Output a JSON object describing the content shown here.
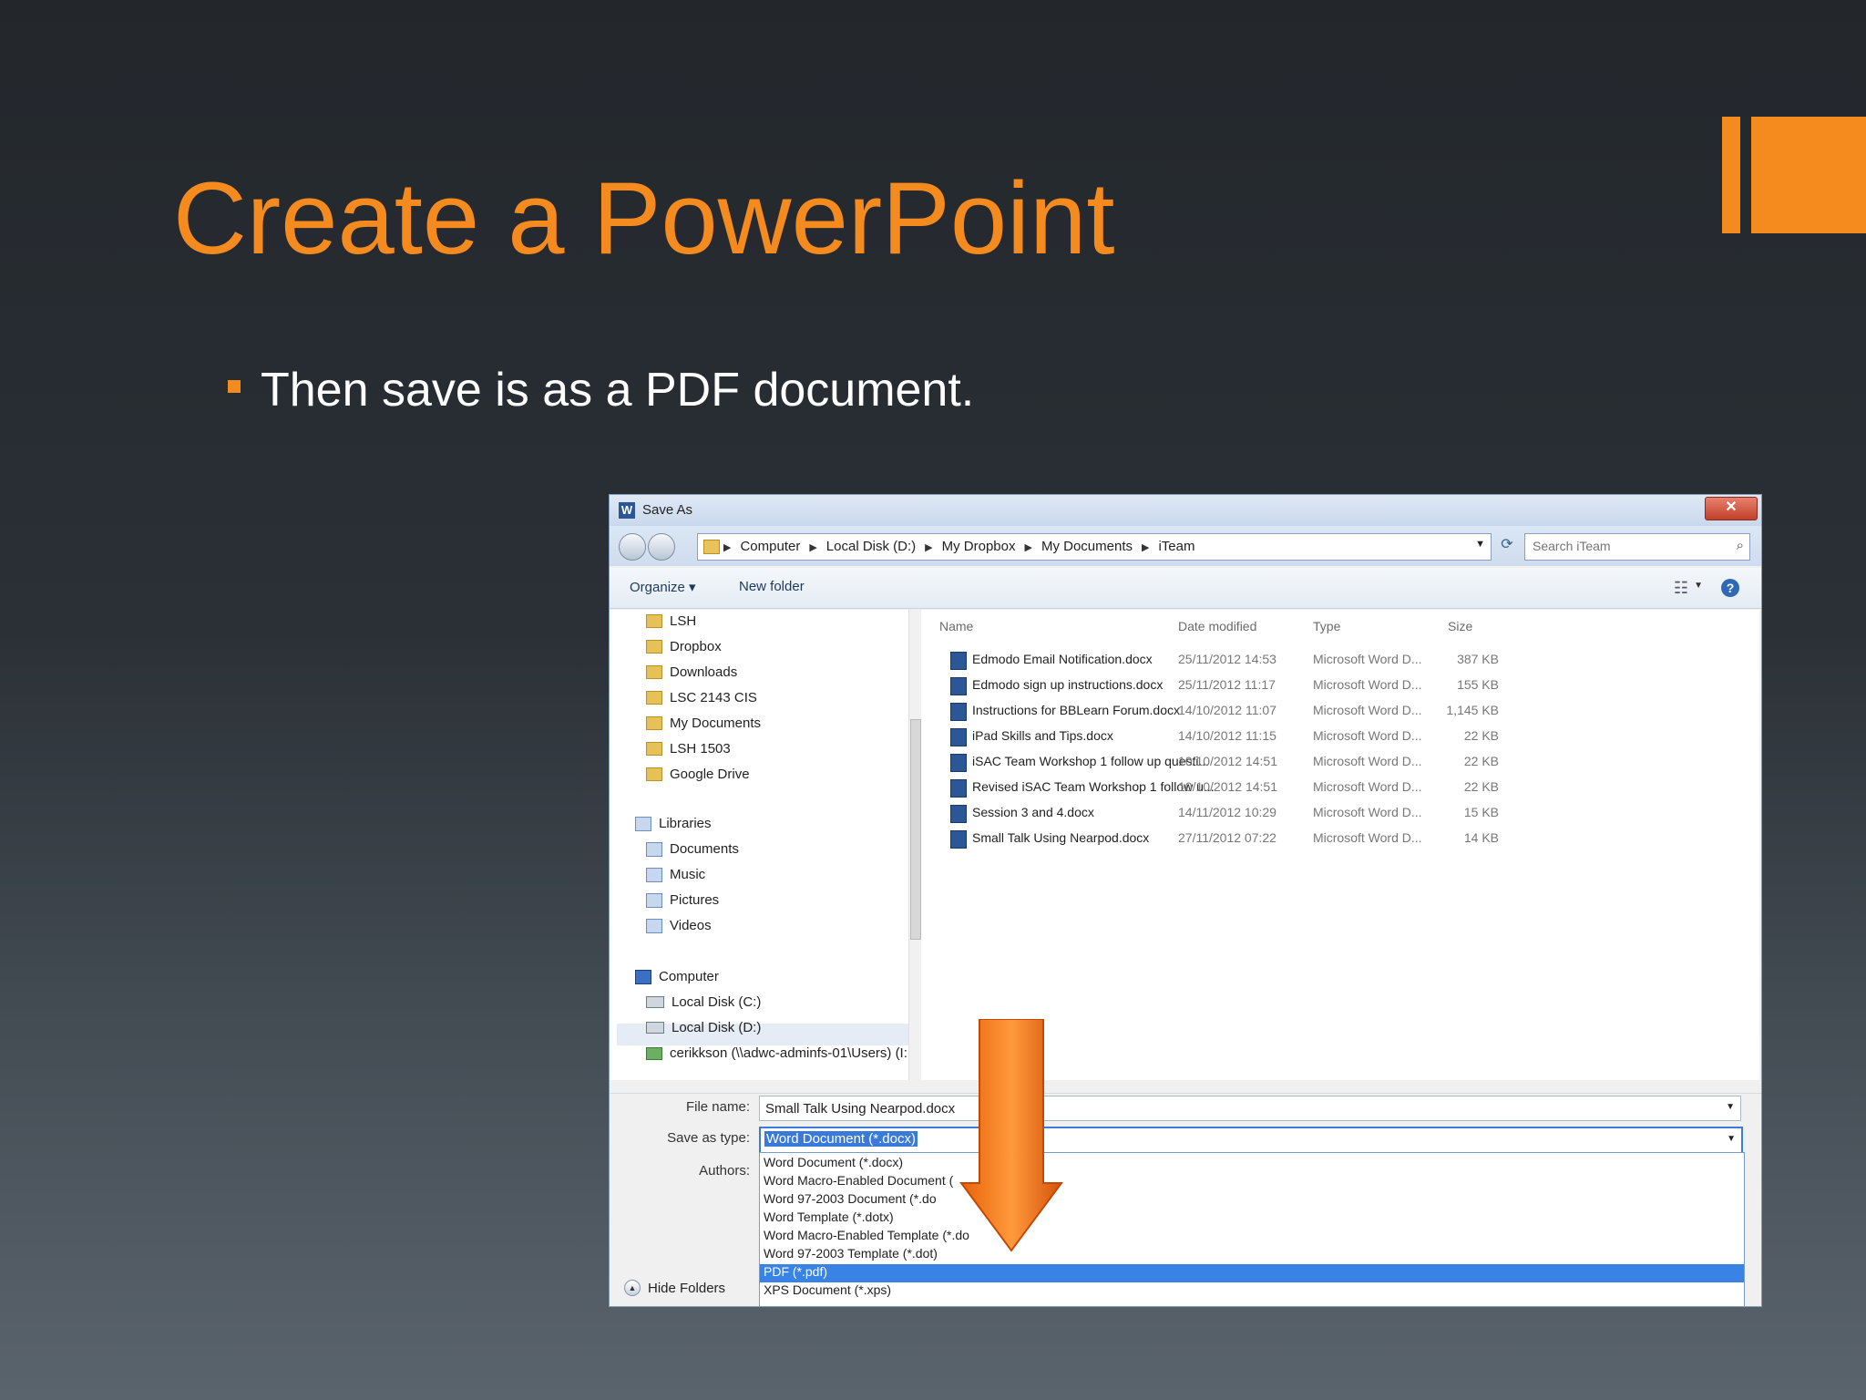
{
  "slide": {
    "title": "Create a PowerPoint",
    "bullet": "Then save is as a PDF document."
  },
  "colors": {
    "accent": "#f58a1f",
    "selection": "#3a83e6"
  },
  "dialog": {
    "app_icon": "W",
    "title": "Save As",
    "close_icon": "close-icon",
    "breadcrumb": [
      "Computer",
      "Local Disk (D:)",
      "My Dropbox",
      "My Documents",
      "iTeam"
    ],
    "search_placeholder": "Search iTeam",
    "toolbar": {
      "organize": "Organize ▾",
      "new_folder": "New folder",
      "help": "?"
    },
    "nav": {
      "favorites": [
        "LSH",
        "Dropbox",
        "Downloads",
        "LSC 2143 CIS",
        "My Documents",
        "LSH 1503",
        "Google Drive"
      ],
      "libraries_label": "Libraries",
      "libraries": [
        "Documents",
        "Music",
        "Pictures",
        "Videos"
      ],
      "computer_label": "Computer",
      "drives": [
        "Local Disk (C:)",
        "Local Disk (D:)",
        "cerikkson (\\\\adwc-adminfs-01\\Users) (I:"
      ]
    },
    "columns": {
      "name": "Name",
      "date": "Date modified",
      "type": "Type",
      "size": "Size"
    },
    "files": [
      {
        "name": "Edmodo Email Notification.docx",
        "date": "25/11/2012 14:53",
        "type": "Microsoft Word D...",
        "size": "387 KB"
      },
      {
        "name": "Edmodo sign up instructions.docx",
        "date": "25/11/2012 11:17",
        "type": "Microsoft Word D...",
        "size": "155 KB"
      },
      {
        "name": "Instructions for BBLearn Forum.docx",
        "date": "14/10/2012 11:07",
        "type": "Microsoft Word D...",
        "size": "1,145 KB"
      },
      {
        "name": "iPad Skills and Tips.docx",
        "date": "14/10/2012 11:15",
        "type": "Microsoft Word D...",
        "size": "22 KB"
      },
      {
        "name": "iSAC Team Workshop 1 follow up questi...",
        "date": "10/10/2012 14:51",
        "type": "Microsoft Word D...",
        "size": "22 KB"
      },
      {
        "name": "Revised iSAC Team Workshop 1 follow u...",
        "date": "10/10/2012 14:51",
        "type": "Microsoft Word D...",
        "size": "22 KB"
      },
      {
        "name": "Session 3 and 4.docx",
        "date": "14/11/2012 10:29",
        "type": "Microsoft Word D...",
        "size": "15 KB"
      },
      {
        "name": "Small Talk Using Nearpod.docx",
        "date": "27/11/2012 07:22",
        "type": "Microsoft Word D...",
        "size": "14 KB"
      }
    ],
    "labels": {
      "file_name": "File name:",
      "save_as_type": "Save as type:",
      "authors": "Authors:"
    },
    "file_name_value": "Small Talk Using Nearpod.docx",
    "save_type_value": "Word Document (*.docx)",
    "type_options": [
      "Word Document (*.docx)",
      "Word Macro-Enabled Document (",
      "Word 97-2003 Document (*.do",
      "Word Template (*.dotx)",
      "Word Macro-Enabled Template (*.do",
      "Word 97-2003 Template (*.dot)",
      "PDF (*.pdf)",
      "XPS Document (*.xps)"
    ],
    "selected_type": "PDF (*.pdf)",
    "hide_folders": "Hide Folders"
  }
}
